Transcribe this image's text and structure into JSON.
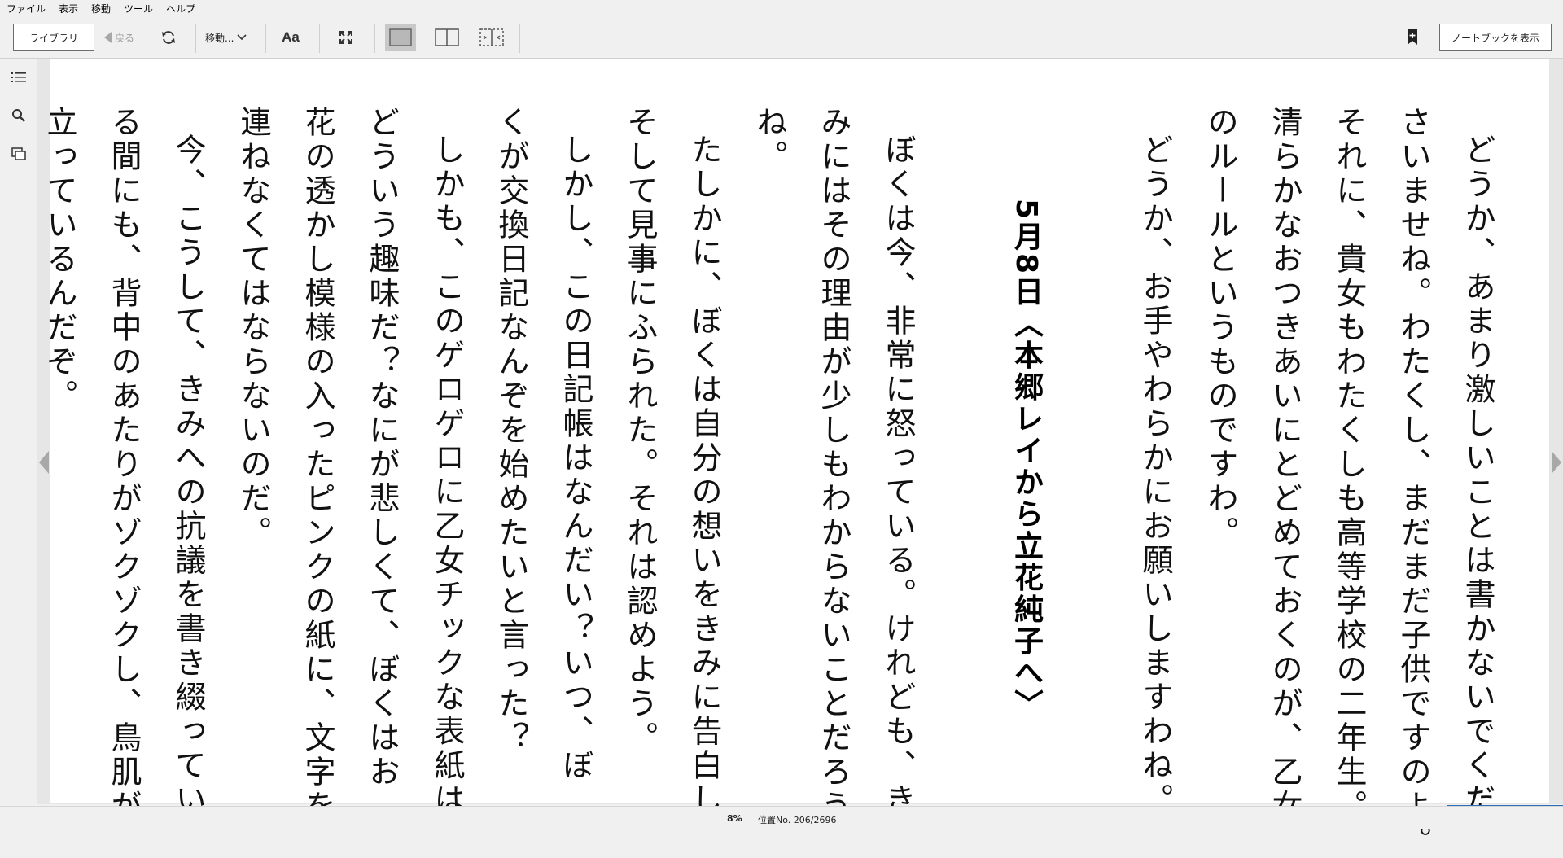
{
  "menu": [
    "ファイル",
    "表示",
    "移動",
    "ツール",
    "ヘルプ"
  ],
  "toolbar": {
    "library_label": "ライブラリ",
    "back_label": "戻る",
    "move_label": "移動...",
    "font_label": "Aa",
    "notebook_label": "ノートブックを表示"
  },
  "icons": {
    "back": "triangle-left-icon",
    "sync": "sync-icon",
    "move": "chevron-down-icon",
    "fullscreen": "fullscreen-icon",
    "single_page": "single-page-layout-icon",
    "two_page": "two-page-layout-icon",
    "scroll_layout": "continuous-layout-icon",
    "bookmark": "bookmark-add-icon",
    "toc": "table-of-contents-icon",
    "search": "search-icon",
    "flashcards": "flashcards-icon",
    "prev_page": "prev-page-arrow-icon",
    "next_page": "next-page-arrow-icon"
  },
  "book": {
    "columns": [
      "どうか、あまり激しいことは書かないでくだ",
      "さいませね。わたくし、まだまだ子供ですのよ。",
      "それに、貴女もわたくしも高等学校の二年生。",
      "清らかなおつきあいにとどめておくのが、乙女",
      "のルールというものですわ。",
      "どうか、お手やわらかにお願いしますわね。",
      "5月8日〈本郷レイから立花純子へ〉",
      "ぼくは今、非常に怒っている。けれども、き",
      "みにはその理由が少しもわからないことだろう",
      "ね。",
      "たしかに、ぼくは自分の想いをきみに告白し、",
      "そして見事にふられた。それは認めよう。",
      "しかし、この日記帳はなんだい？いつ、ぼ",
      "くが交換日記なんぞを始めたいと言った？",
      "しかも、このゲロゲロに乙女チックな表紙は",
      "どういう趣味だ？なにが悲しくて、ぼくはお",
      "花の透かし模様の入ったピンクの紙に、文字を",
      "連ねなくてはならないのだ。",
      "今、こうして、きみへの抗議を書き綴ってい",
      "る間にも、背中のあたりがゾクゾクし、鳥肌が",
      "立っているんだぞ。"
    ]
  },
  "status": {
    "percent": "8%",
    "location": "位置No. 206/2696",
    "progress_fraction": 0.08
  },
  "colors": {
    "accent": "#2a6fb6",
    "background": "#f0f0f0"
  }
}
